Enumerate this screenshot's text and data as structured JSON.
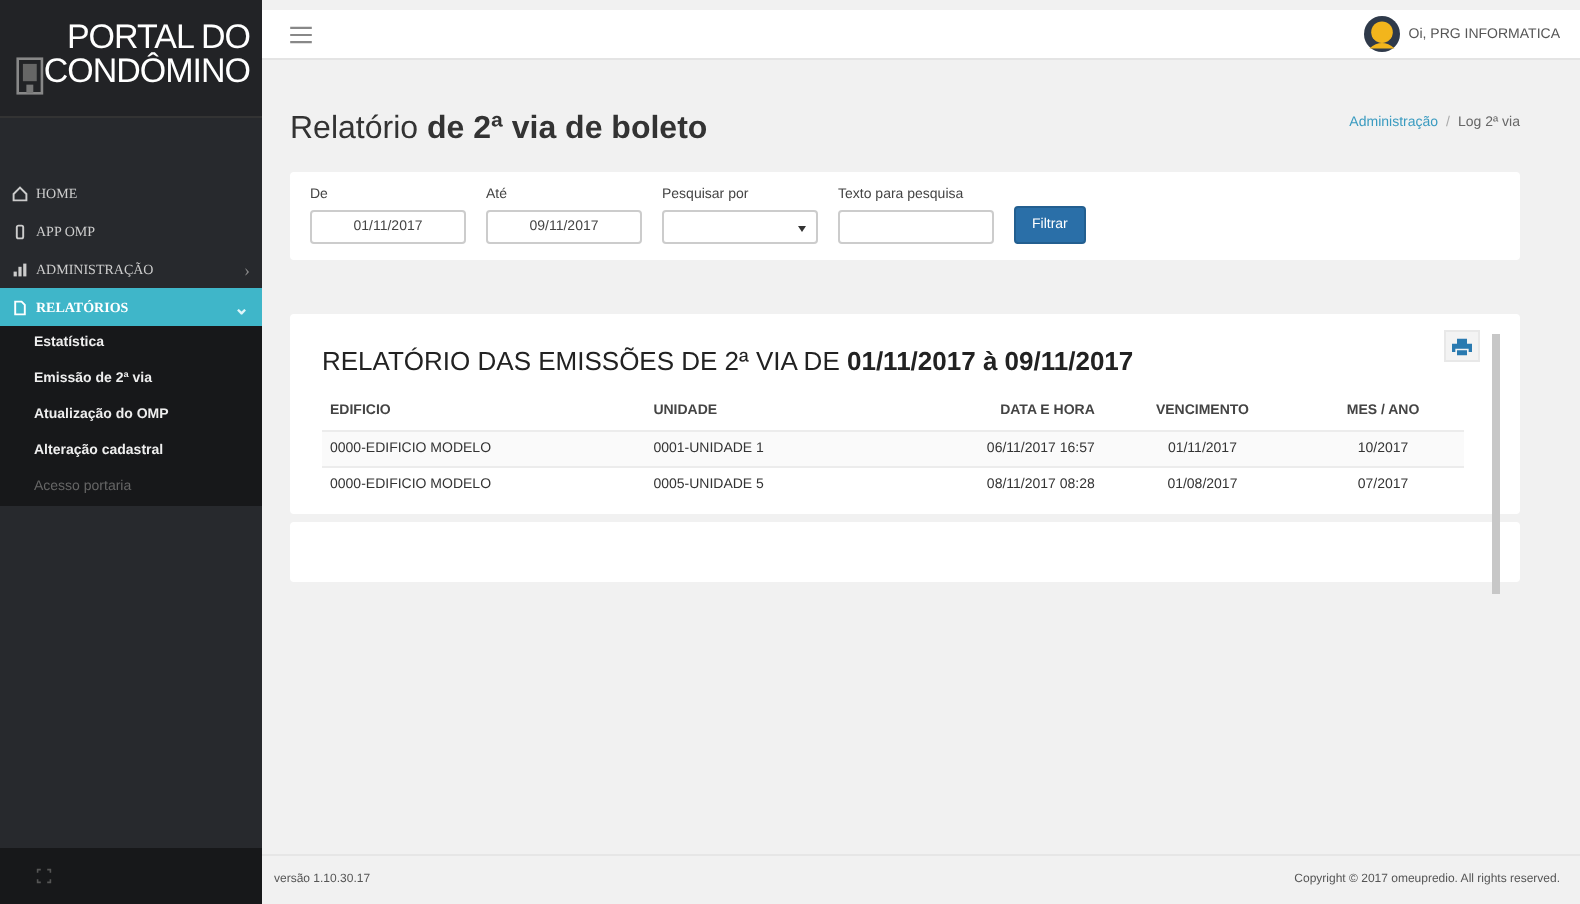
{
  "logo": {
    "line_1": "PORTAL DO",
    "line_2": "CONDÔMINO"
  },
  "sidebar": {
    "items": [
      {
        "label": "HOME",
        "selected": false
      },
      {
        "label": "APP OMP",
        "selected": false
      },
      {
        "label": "ADMINISTRAÇÃO",
        "selected": false,
        "caret": "›"
      },
      {
        "label": "RELATÓRIOS",
        "selected": true,
        "caret": "⌄",
        "children": [
          {
            "label": "Estatística",
            "selected": false,
            "disabled": false
          },
          {
            "label": "Emissão de 2ª via",
            "selected": false,
            "disabled": false
          },
          {
            "label": "Atualização do OMP",
            "selected": false,
            "disabled": false
          },
          {
            "label": "Alteração cadastral",
            "selected": false,
            "disabled": false
          },
          {
            "label": "Acesso portaria",
            "selected": false,
            "disabled": true
          }
        ]
      }
    ]
  },
  "topbar": {
    "user": "Oi, PRG INFORMATICA"
  },
  "page_title": "Relatório **de 2ª via de boleto**",
  "breadcrumb": {
    "separator": "/",
    "items": [
      {
        "label": "Administração",
        "link": true
      },
      {
        "label": "Log 2ª via",
        "link": false
      }
    ]
  },
  "filters": {
    "fields": [
      {
        "label": "De",
        "kind": "input",
        "value": "01/11/2017"
      },
      {
        "label": "Até",
        "kind": "input",
        "value": "09/11/2017"
      },
      {
        "label": "Pesquisar por",
        "kind": "select"
      },
      {
        "label": "Texto para pesquisa",
        "kind": "input"
      }
    ],
    "button": "Filtrar"
  },
  "report": {
    "heading": "RELATÓRIO DAS EMISSÕES DE 2ª VIA DE **01/11/2017 à 09/11/2017**",
    "columns": [
      "EDIFICIO",
      "UNIDADE",
      "DATA E HORA",
      "VENCIMENTO",
      "MES / ANO"
    ],
    "rows": [
      [
        "0000-EDIFICIO MODELO",
        "0001-UNIDADE 1",
        "06/11/2017 16:57",
        "01/11/2017",
        "10/2017"
      ],
      [
        "0000-EDIFICIO MODELO",
        "0005-UNIDADE 5",
        "08/11/2017 08:28",
        "01/08/2017",
        "07/2017"
      ]
    ]
  },
  "footer": {
    "version": "versão 1.10.30.17",
    "copyright": "Copyright © 2017 omeupredio. All rights reserved."
  }
}
